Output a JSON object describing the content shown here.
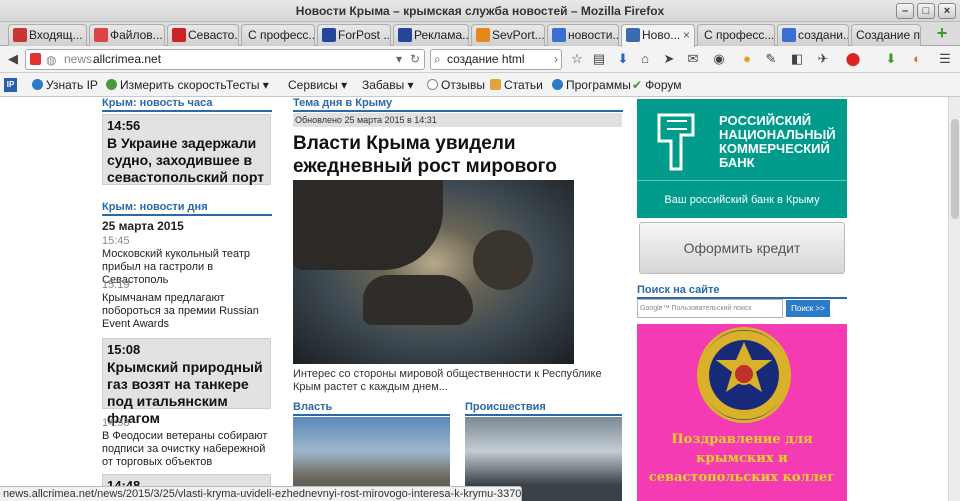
{
  "window": {
    "title": "Новости Крыма – крымская служба новостей – Mozilla Firefox"
  },
  "tabs": [
    {
      "label": "Входящ..."
    },
    {
      "label": "Файлов..."
    },
    {
      "label": "Севасто..."
    },
    {
      "label": "С професс..."
    },
    {
      "label": "ForPost ..."
    },
    {
      "label": "Реклама..."
    },
    {
      "label": "SevPort..."
    },
    {
      "label": "новости..."
    },
    {
      "label": "Ново..."
    },
    {
      "label": "С професс..."
    },
    {
      "label": "создани..."
    },
    {
      "label": "Создание п..."
    }
  ],
  "nav": {
    "url_prefix": "news.",
    "url_domain": "allcrimea.net",
    "search_value": "создание html"
  },
  "bookmarks": [
    "Узнать IP",
    "Измерить скорость",
    "Тесты",
    "Сервисы",
    "Забавы",
    "Отзывы",
    "Статьи",
    "Программы",
    "Форум"
  ],
  "left": {
    "hour_header": "Крым: новость часа",
    "hour_news": {
      "time": "14:56",
      "title": "В Украине задержали судно, заходившее в севастопольский порт"
    },
    "day_header": "Крым: новости дня",
    "date": "25 марта 2015",
    "items": [
      {
        "time": "15:45",
        "text": "Московский кукольный театр прибыл на гастроли в Севастополь"
      },
      {
        "time": "15:19",
        "text": "Крымчанам предлагают побороться за премии Russian Event Awards"
      }
    ],
    "highlight": {
      "time": "15:08",
      "title": "Крымский природный газ возят на танкере под итальянским флагом"
    },
    "items2": [
      {
        "time": "14:58",
        "text": "В Феодосии ветераны собирают подписи за очистку набережной от торговых объектов"
      }
    ],
    "partial_time": "14:48"
  },
  "center": {
    "topic_header": "Тема дня в Крыму",
    "updated": "Обновлено 25 марта 2015 в 14:31",
    "title": "Власти Крыма увидели ежедневный рост мирового интереса к Крыму",
    "caption": "Интерес со стороны мировой общественности к Республике Крым растет с каждым днем...",
    "sec1": "Власть",
    "sec2": "Происшествия"
  },
  "right": {
    "bank_lines": [
      "РОССИЙСКИЙ",
      "НАЦИОНАЛЬНЫЙ",
      "КОММЕРЧЕСКИЙ",
      "БАНК"
    ],
    "bank_slogan": "Ваш российский банк в Крыму",
    "credit_btn": "Оформить кредит",
    "search_header": "Поиск на сайте",
    "search_placeholder": "Google™ Пользовательский поиск",
    "search_btn": "Поиск >>",
    "pink_text": "Поздравление для крымских и севастопольских коллег"
  },
  "status": "news.allcrimea.net/news/2015/3/25/vlasti-kryma-uvideli-ezhednevnyi-rost-mirovogo-interesa-k-krymu-33705/"
}
